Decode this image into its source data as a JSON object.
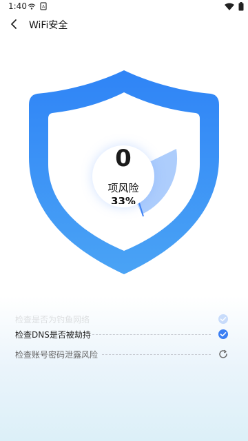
{
  "status_bar": {
    "time": "1:40",
    "icons_left": [
      "wifi-signal-icon",
      "sim-card-icon"
    ],
    "icons_right": [
      "wifi-icon",
      "battery-icon"
    ]
  },
  "header": {
    "back_icon": "chevron-left-icon",
    "title": "WiFi安全"
  },
  "scan": {
    "risk_count": "0",
    "risk_label": "项风险",
    "progress_text": "33%",
    "progress_value": 0.33,
    "colors": {
      "shield_top": "#2f84f6",
      "shield_bottom": "#4aa3f5",
      "sweep": "#a9cafc",
      "accent": "#3b7ff3"
    }
  },
  "checks": [
    {
      "label": "检查是否为钓鱼网络",
      "status": "done",
      "status_icon": "check-circle-icon"
    },
    {
      "label": "检查DNS是否被劫持",
      "status": "done",
      "status_icon": "check-circle-icon"
    },
    {
      "label": "检查账号密码泄露风险",
      "status": "in-progress",
      "status_icon": "refresh-icon"
    }
  ]
}
